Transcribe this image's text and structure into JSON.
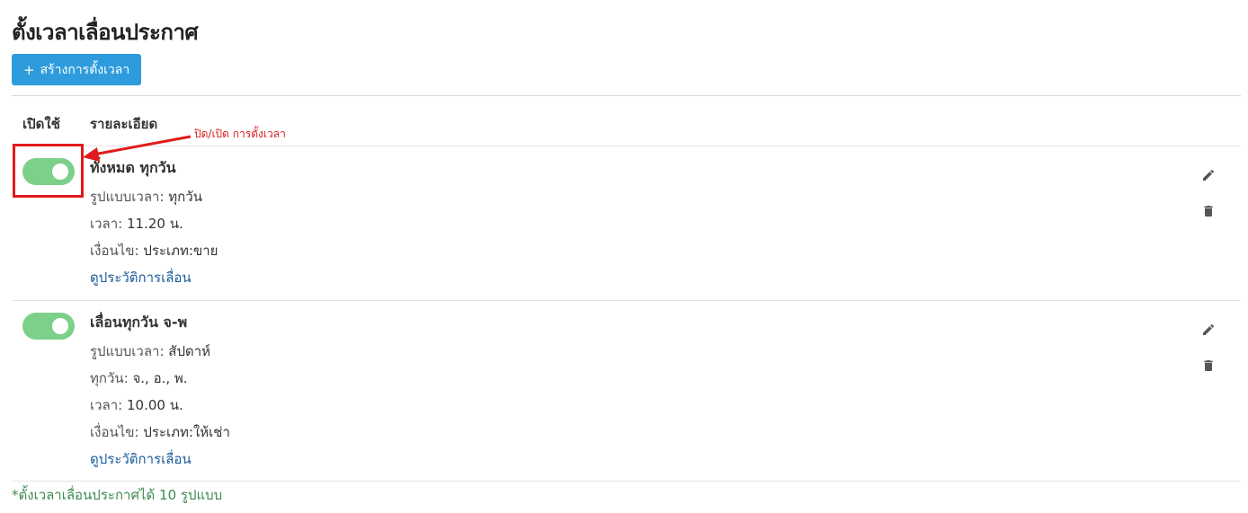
{
  "page": {
    "title": "ตั้งเวลาเลื่อนประกาศ"
  },
  "toolbar": {
    "create_label": "สร้างการตั้งเวลา",
    "create_icon": "plus-icon"
  },
  "table": {
    "columns": {
      "enable": "เปิดใช้",
      "detail": "รายละเอียด"
    }
  },
  "annotation": {
    "text": "ปิด/เปิด การตั้งเวลา",
    "color": "#e11b1b"
  },
  "schedules": [
    {
      "enabled": true,
      "title": "ทั้งหมด ทุกวัน",
      "format_label": "รูปแบบเวลา:",
      "format_value": "ทุกวัน",
      "time_label": "เวลา:",
      "time_value": "11.20 น.",
      "condition_label": "เงื่อนไข:",
      "condition_value": "ประเภท:ขาย",
      "history_link": "ดูประวัติการเลื่อน"
    },
    {
      "enabled": true,
      "title": "เลื่อนทุกวัน จ-พ",
      "format_label": "รูปแบบเวลา:",
      "format_value": "สัปดาห์",
      "days_label": "ทุกวัน:",
      "days_value": "จ., อ., พ.",
      "time_label": "เวลา:",
      "time_value": "10.00 น.",
      "condition_label": "เงื่อนไข:",
      "condition_value": "ประเภท:ให้เช่า",
      "history_link": "ดูประวัติการเลื่อน"
    }
  ],
  "footnote": "*ตั้งเวลาเลื่อนประกาศได้ 10 รูปแบบ",
  "colors": {
    "primary_button": "#2e9bdc",
    "toggle_on": "#7dd08a",
    "link": "#1a5c9c",
    "footnote": "#3e8a4e"
  }
}
